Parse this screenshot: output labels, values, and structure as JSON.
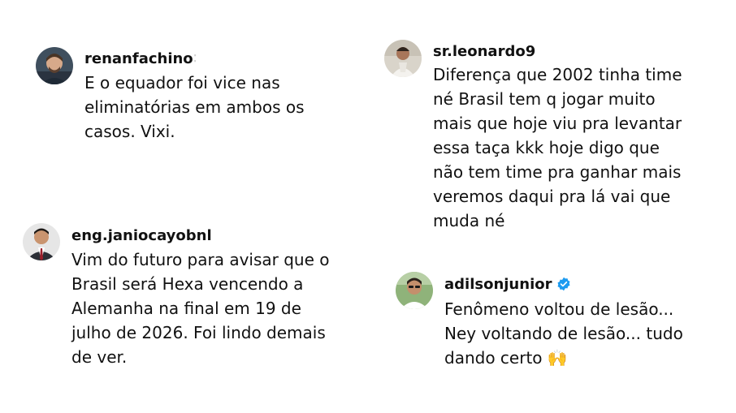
{
  "comments": [
    {
      "username": "renanfachino",
      "username_fragment": "∶",
      "lines": [
        "E o equador foi vice nas",
        "eliminatórias em ambos os",
        "casos. Vixi."
      ]
    },
    {
      "username": "sr.leonardo9",
      "lines": [
        "Diferença que 2002 tinha time",
        "né Brasil tem q jogar muito",
        "mais que hoje viu pra levantar",
        "essa taça kkk hoje digo que",
        "não tem time pra ganhar mais",
        "veremos daqui pra lá vai que",
        "muda né"
      ]
    },
    {
      "username": "eng.janiocayobnl",
      "lines": [
        "Vim do futuro para avisar que o",
        "Brasil será Hexa vencendo a",
        "Alemanha na final em 19 de",
        "julho de 2026. Foi lindo demais",
        "de ver."
      ]
    },
    {
      "username": "adilsonjunior",
      "verified": true,
      "lines": [
        "Fenômeno voltou de lesão...",
        "Ney voltando de lesão... tudo",
        "dando certo 🙌"
      ]
    }
  ],
  "icons": {
    "verified": "verified-badge-icon",
    "verified_color": "#1d9bf0"
  }
}
